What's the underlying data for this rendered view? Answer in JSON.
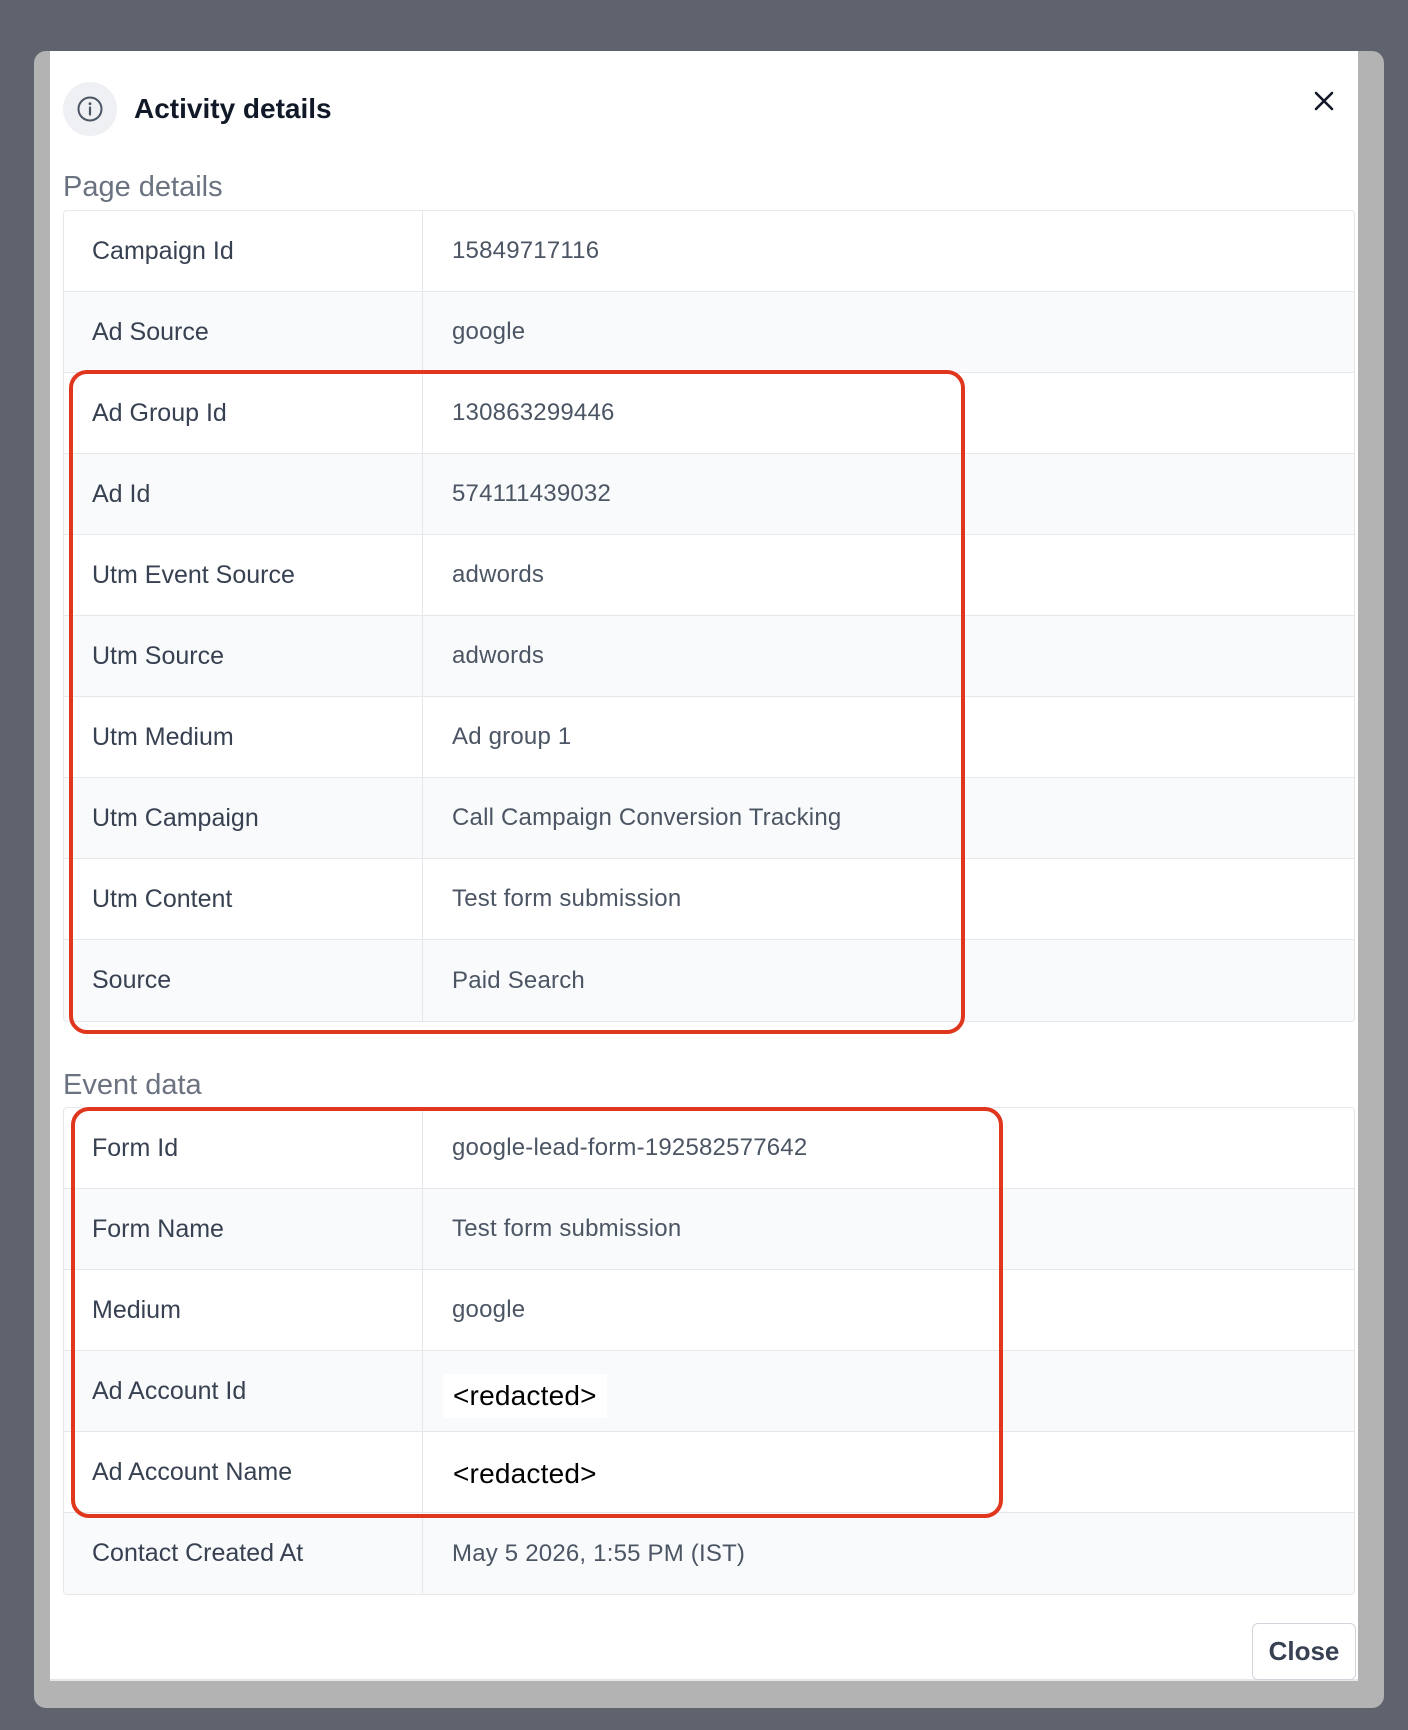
{
  "dialog": {
    "title": "Activity details",
    "close_button_label": "Close"
  },
  "page_details": {
    "heading": "Page details",
    "rows": [
      {
        "label": "Campaign Id",
        "value": "15849717116"
      },
      {
        "label": "Ad Source",
        "value": "google"
      },
      {
        "label": "Ad Group Id",
        "value": "130863299446"
      },
      {
        "label": "Ad Id",
        "value": "574111439032"
      },
      {
        "label": "Utm Event Source",
        "value": "adwords"
      },
      {
        "label": "Utm Source",
        "value": "adwords"
      },
      {
        "label": "Utm Medium",
        "value": "Ad group 1"
      },
      {
        "label": "Utm Campaign",
        "value": "Call Campaign Conversion Tracking"
      },
      {
        "label": "Utm Content",
        "value": "Test form submission"
      },
      {
        "label": "Source",
        "value": "Paid Search"
      }
    ]
  },
  "event_data": {
    "heading": "Event data",
    "rows": [
      {
        "label": "Form Id",
        "value": "google-lead-form-192582577642"
      },
      {
        "label": "Form Name",
        "value": "Test form submission"
      },
      {
        "label": "Medium",
        "value": "google"
      },
      {
        "label": "Ad Account Id",
        "value": "<redacted>"
      },
      {
        "label": "Ad Account Name",
        "value": "<redacted>"
      },
      {
        "label": "Contact Created At",
        "value": "May 5 2026, 1:55 PM (IST)"
      }
    ]
  },
  "colors": {
    "highlight": "#e0361e",
    "overlay": "#5f636d"
  },
  "icons": {
    "header": "info-icon",
    "close": "close-icon"
  }
}
